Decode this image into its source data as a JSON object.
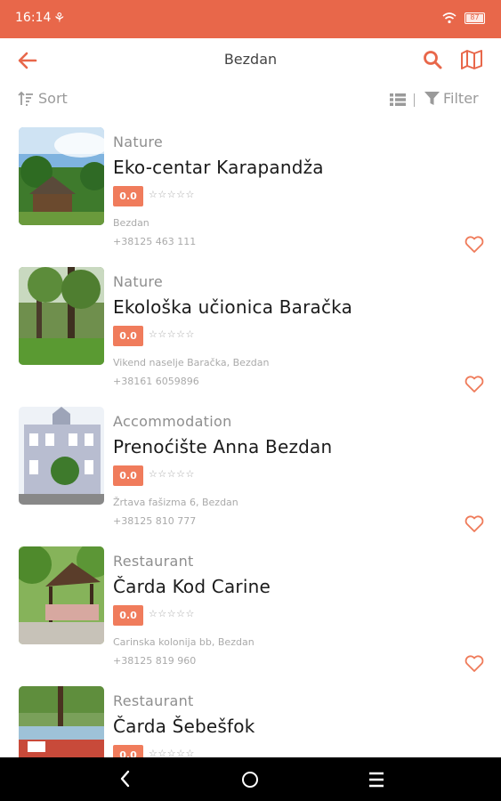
{
  "status_bar": {
    "time": "16:14",
    "battery": "87"
  },
  "app_bar": {
    "title": "Bezdan"
  },
  "toolbar": {
    "sort_label": "Sort",
    "filter_label": "Filter"
  },
  "items": [
    {
      "category": "Nature",
      "name": "Eko-centar Karapandža",
      "rating": "0.0",
      "stars": "☆☆☆☆☆",
      "address": "Bezdan",
      "phone": "+38125 463 111"
    },
    {
      "category": "Nature",
      "name": "Ekološka učionica Baračka",
      "rating": "0.0",
      "stars": "☆☆☆☆☆",
      "address": "Vikend naselje Baračka, Bezdan",
      "phone": "+38161 6059896"
    },
    {
      "category": "Accommodation",
      "name": "Prenoćište Anna Bezdan",
      "rating": "0.0",
      "stars": "☆☆☆☆☆",
      "address": "Žrtava fašizma 6, Bezdan",
      "phone": "+38125 810 777"
    },
    {
      "category": "Restaurant",
      "name": "Čarda Kod Carine",
      "rating": "0.0",
      "stars": "☆☆☆☆☆",
      "address": "Carinska kolonija bb, Bezdan",
      "phone": "+38125 819 960"
    },
    {
      "category": "Restaurant",
      "name": "Čarda Šebešfok",
      "rating": "0.0",
      "stars": "☆☆☆☆☆"
    }
  ],
  "colors": {
    "accent": "#e8674a",
    "badge": "#f07c5c"
  },
  "icons": [
    "back-arrow-icon",
    "search-icon",
    "map-icon",
    "sort-icon",
    "list-view-icon",
    "filter-icon",
    "heart-icon"
  ]
}
